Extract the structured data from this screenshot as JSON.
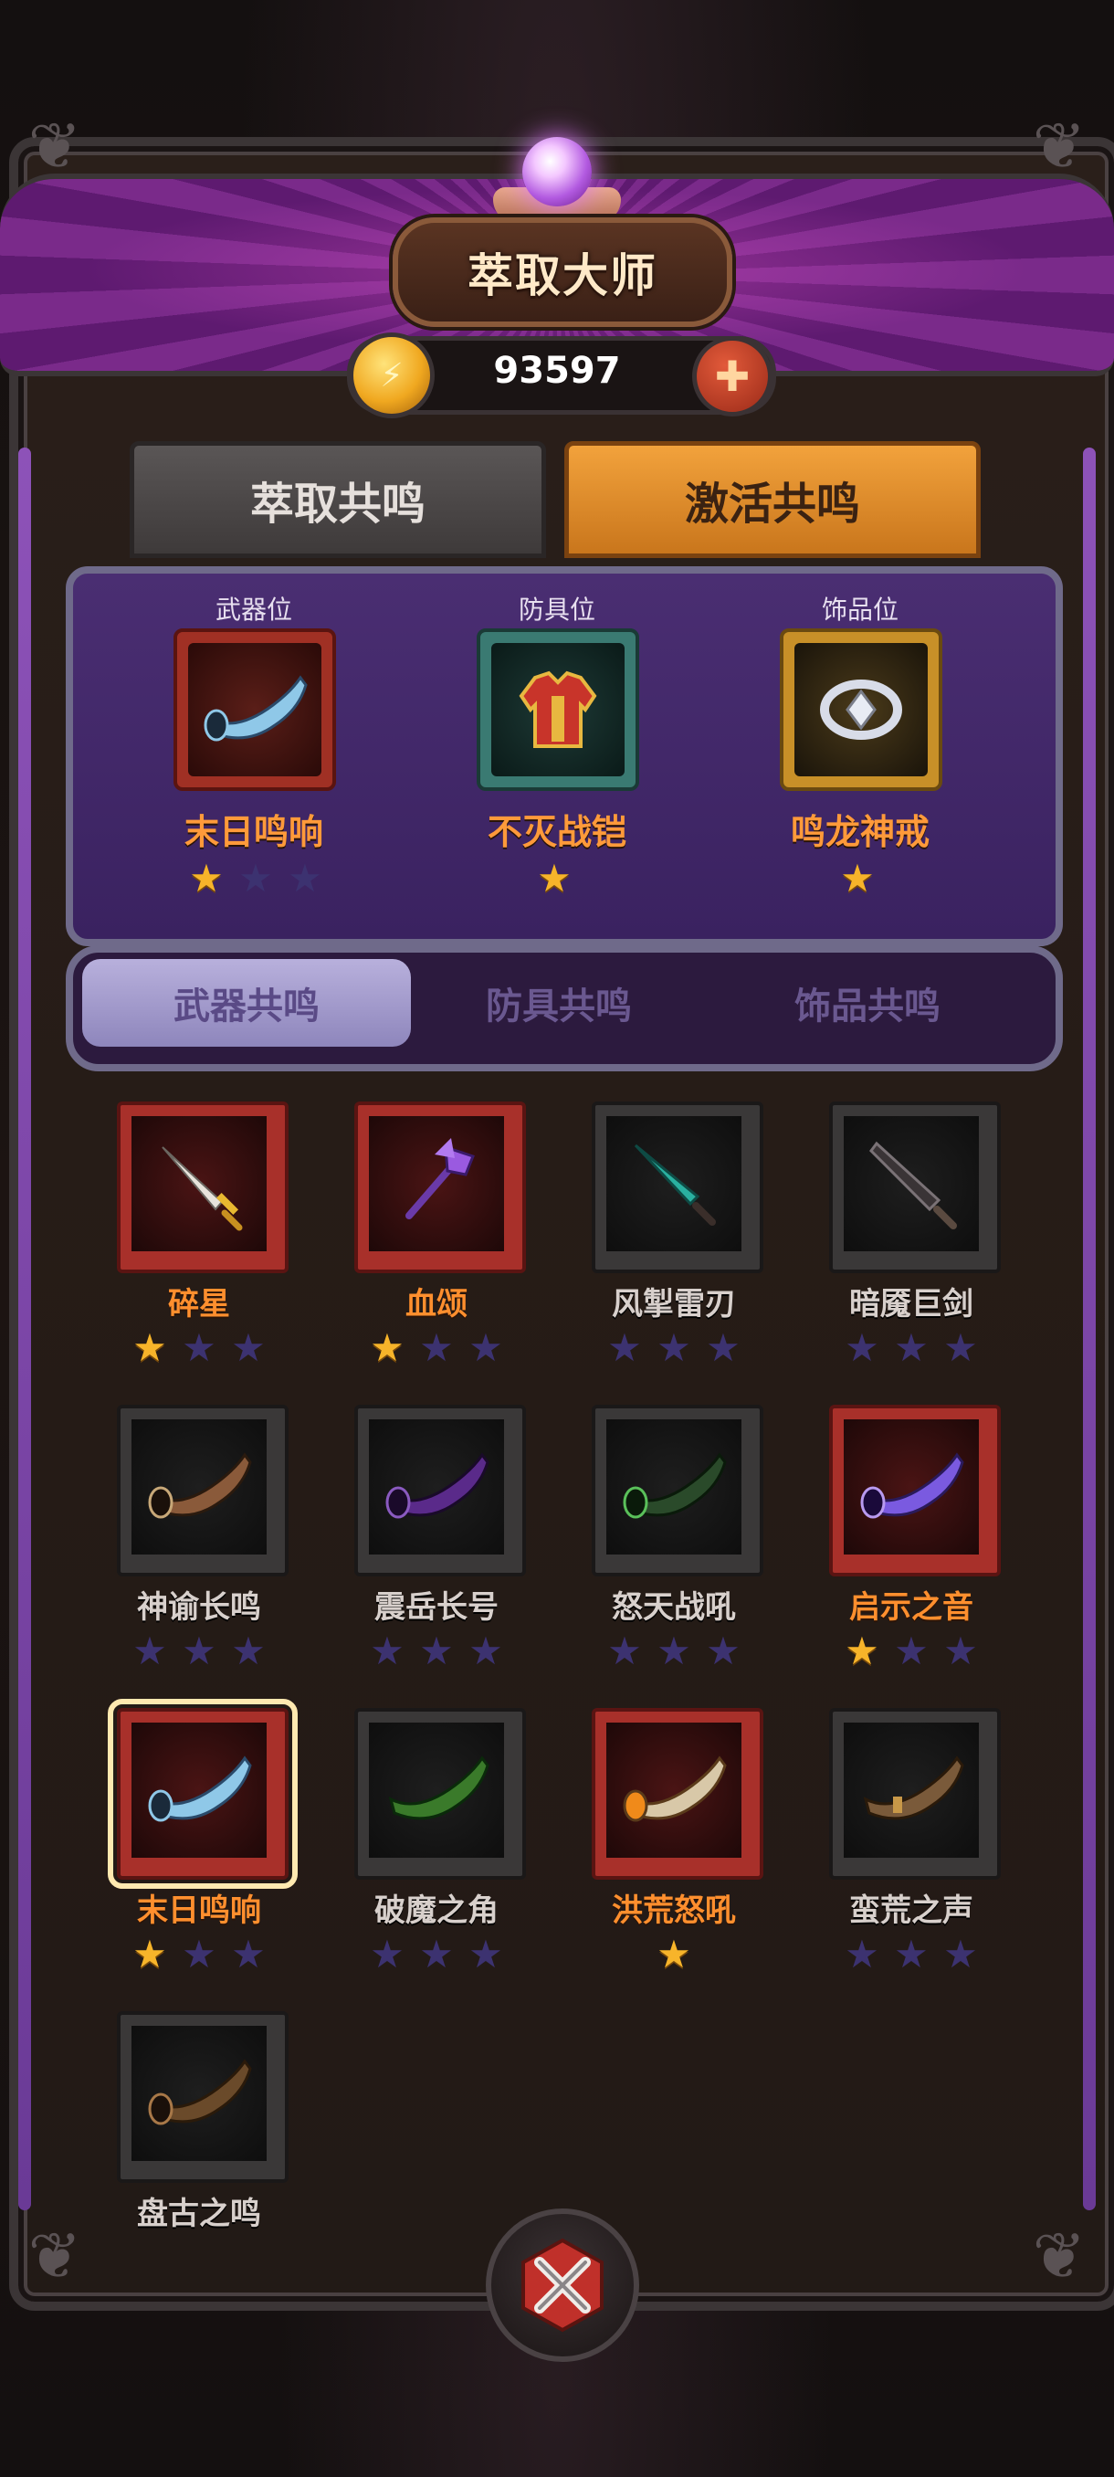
{
  "header": {
    "title": "萃取大师",
    "currency_amount": "93597",
    "currency_icon": "gold-coin-icon",
    "add_icon": "plus-icon"
  },
  "main_tabs": [
    {
      "label": "萃取共鸣",
      "active": false
    },
    {
      "label": "激活共鸣",
      "active": true
    }
  ],
  "equipped_slots": [
    {
      "slot_label": "武器位",
      "item_name": "末日鸣响",
      "icon": "horn-icon",
      "stars_filled": 1,
      "stars_total": 3,
      "rarity_color": "#a03024"
    },
    {
      "slot_label": "防具位",
      "item_name": "不灭战铠",
      "icon": "armor-icon",
      "stars_filled": 1,
      "stars_total": 1,
      "rarity_color": "#3a7a72"
    },
    {
      "slot_label": "饰品位",
      "item_name": "鸣龙神戒",
      "icon": "ring-icon",
      "stars_filled": 1,
      "stars_total": 1,
      "rarity_color": "#c89028"
    }
  ],
  "sub_tabs": [
    {
      "label": "武器共鸣",
      "active": true
    },
    {
      "label": "防具共鸣",
      "active": false
    },
    {
      "label": "饰品共鸣",
      "active": false
    }
  ],
  "items": [
    {
      "name": "碎星",
      "icon": "gold-dagger-icon",
      "frame": "red",
      "stars_filled": 1,
      "stars_total": 3,
      "selected": false
    },
    {
      "name": "血颂",
      "icon": "purple-mace-icon",
      "frame": "red",
      "stars_filled": 1,
      "stars_total": 3,
      "selected": false
    },
    {
      "name": "风掣雷刃",
      "icon": "teal-sword-icon",
      "frame": "grey",
      "stars_filled": 0,
      "stars_total": 3,
      "selected": false
    },
    {
      "name": "暗魇巨剑",
      "icon": "dark-greatsword-icon",
      "frame": "grey",
      "stars_filled": 0,
      "stars_total": 3,
      "selected": false
    },
    {
      "name": "神谕长鸣",
      "icon": "bronze-horn-icon",
      "frame": "grey",
      "stars_filled": 0,
      "stars_total": 3,
      "selected": false
    },
    {
      "name": "震岳长号",
      "icon": "purple-horn-icon",
      "frame": "grey",
      "stars_filled": 0,
      "stars_total": 3,
      "selected": false
    },
    {
      "name": "怒天战吼",
      "icon": "green-horn-icon",
      "frame": "grey",
      "stars_filled": 0,
      "stars_total": 3,
      "selected": false
    },
    {
      "name": "启示之音",
      "icon": "violet-horn-icon",
      "frame": "red",
      "stars_filled": 1,
      "stars_total": 3,
      "selected": false
    },
    {
      "name": "末日鸣响",
      "icon": "blue-horn-icon",
      "frame": "red",
      "stars_filled": 1,
      "stars_total": 3,
      "selected": true
    },
    {
      "name": "破魔之角",
      "icon": "leaf-horn-icon",
      "frame": "grey",
      "stars_filled": 0,
      "stars_total": 3,
      "selected": false
    },
    {
      "name": "洪荒怒吼",
      "icon": "amber-horn-icon",
      "frame": "red",
      "stars_filled": 1,
      "stars_total": 1,
      "selected": false
    },
    {
      "name": "蛮荒之声",
      "icon": "tribal-horn-icon",
      "frame": "grey",
      "stars_filled": 0,
      "stars_total": 3,
      "selected": false
    },
    {
      "name": "盘古之鸣",
      "icon": "ancient-horn-icon",
      "frame": "grey",
      "stars_filled": 0,
      "stars_total": 0,
      "selected": false
    }
  ],
  "footer": {
    "close_icon": "close-x-icon"
  },
  "colors": {
    "accent_orange": "#ff8f2e",
    "active_tab": "#f2a23c",
    "panel_purple": "#4a2e72",
    "star_gold": "#f7b42a",
    "star_empty": "#3c3270"
  }
}
